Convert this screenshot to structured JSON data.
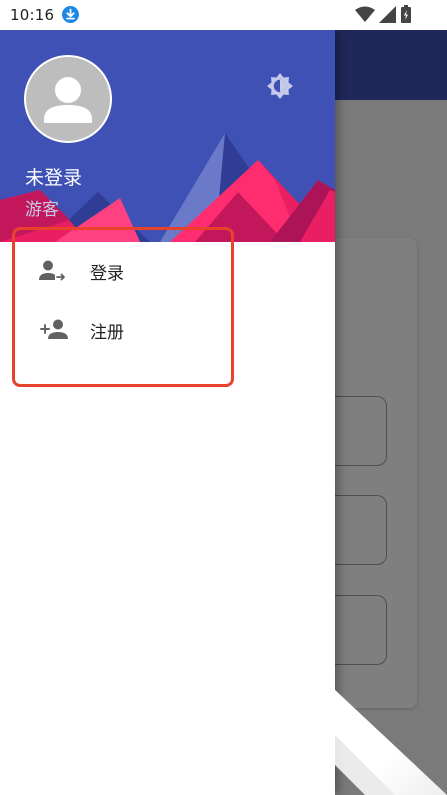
{
  "status_bar": {
    "time": "10:16",
    "icons": [
      "download-icon",
      "wifi-icon",
      "signal-icon",
      "battery-icon"
    ]
  },
  "drawer": {
    "header": {
      "user_name": "未登录",
      "user_role": "游客",
      "avatar_icon": "person-icon",
      "theme_toggle_icon": "brightness-icon"
    },
    "menu": {
      "items": [
        {
          "label": "登录",
          "icon": "login-icon"
        },
        {
          "label": "注册",
          "icon": "person-add-icon"
        }
      ]
    }
  },
  "colors": {
    "primary": "#3f51b5",
    "accent_pink": "#e91e63",
    "highlight": "#e8412c"
  }
}
